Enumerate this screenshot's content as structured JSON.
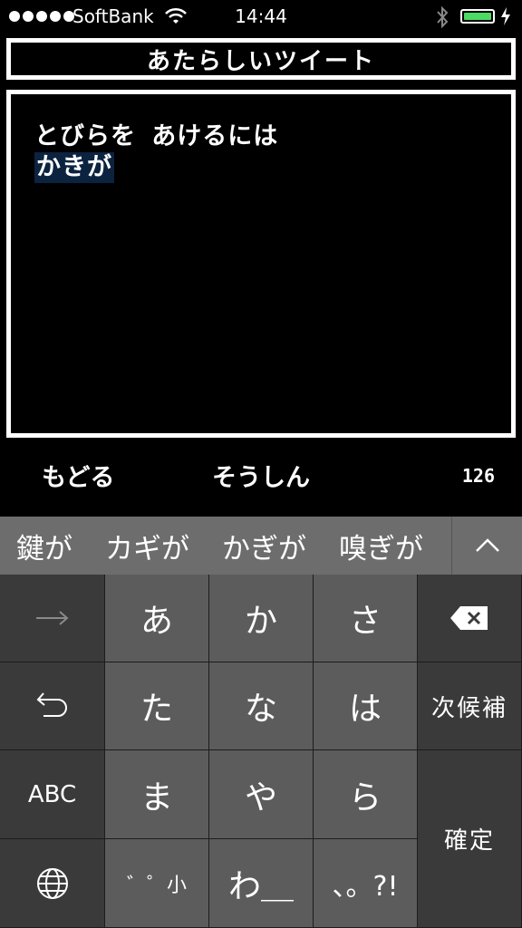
{
  "status_bar": {
    "carrier": "SoftBank",
    "time": "14:44",
    "signal_bars": 5,
    "battery_color": "#4cd964"
  },
  "title": "あたらしいツイート",
  "editor": {
    "line1": "とびらを あけるには",
    "line2_marked": "かきが"
  },
  "actions": {
    "back_label": "もどる",
    "send_label": "そうしん",
    "char_count": "126"
  },
  "candidates": {
    "items": [
      "鍵が",
      "カギが",
      "かぎが",
      "嗅ぎが"
    ],
    "expand_icon": "chevron-up-icon"
  },
  "keyboard": {
    "next_icon": "arrow-right-icon",
    "undo_icon": "undo-icon",
    "abc_label": "ABC",
    "globe_icon": "globe-icon",
    "keys": [
      "あ",
      "か",
      "さ",
      "た",
      "な",
      "は",
      "ま",
      "や",
      "ら",
      "゛゜小",
      "わ＿",
      "、。?!"
    ],
    "delete_icon": "delete-icon",
    "next_candidate_label": "次候補",
    "confirm_label": "確定"
  }
}
